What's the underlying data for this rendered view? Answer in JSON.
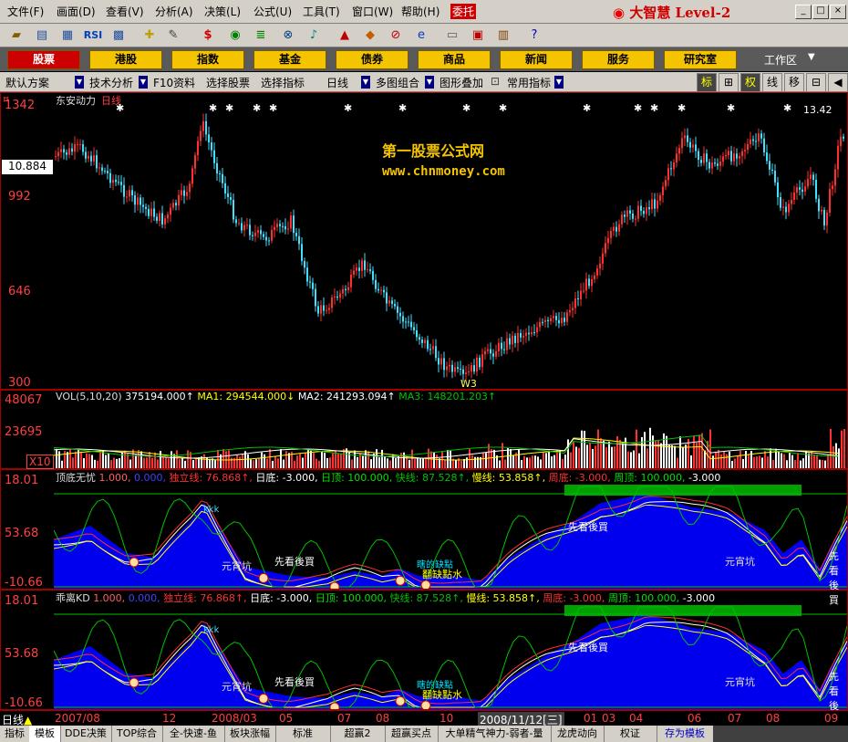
{
  "menu": [
    "文件(F)",
    "画面(D)",
    "查看(V)",
    "分析(A)",
    "决策(L)",
    "公式(U)",
    "工具(T)",
    "窗口(W)",
    "帮助(H)",
    "委托"
  ],
  "logo_text": "大智慧 Level-2",
  "markets": [
    "股票",
    "港股",
    "指数",
    "基金",
    "债券",
    "商品",
    "新闻",
    "服务",
    "研究室"
  ],
  "workspace_label": "工作区",
  "subbar": {
    "items": [
      "默认方案",
      "技术分析",
      "F10资料",
      "选择股票",
      "选择指标",
      "日线",
      "多图组合",
      "图形叠加",
      "常用指标"
    ],
    "right_buttons": [
      "标",
      "⊞",
      "权",
      "线",
      "移",
      "⊟",
      "◀"
    ]
  },
  "main_chart": {
    "stock_name": "东安动力",
    "period": "日线",
    "price_labels": [
      "1342",
      "992",
      "646",
      "300"
    ],
    "current_price": "10.884",
    "watermark_line1": "第一股票公式网",
    "watermark_line2": "www.chnmoney.com",
    "low_marker": "W3",
    "top_right_label": "13.42"
  },
  "volume": {
    "legend": [
      "VOL(5,10,20)",
      "375194.000↑",
      "MA1: 294544.000↓",
      "MA2: 241293.094↑",
      "MA3: 148201.203↑"
    ],
    "labels": [
      "48067",
      "23695"
    ],
    "multiplier": "X10"
  },
  "indicator1": {
    "name": "顶底无忧",
    "legend": [
      "1.000,",
      "0.000,",
      "独立线: 76.868↑,",
      "日底: -3.000,",
      "日顶: 100.000,",
      "快线: 87.528↑,",
      "慢线: 53.858↑,",
      "周底: -3.000,",
      "周顶: 100.000,",
      "-3.000"
    ],
    "labels": [
      "18.01",
      "53.68",
      "-10.66"
    ],
    "annotations": [
      "kkk",
      "元宵坑",
      "先看後買",
      "先看後買",
      "瞎的缺點",
      "翻缺點水",
      "元宵坑",
      "先看後買"
    ]
  },
  "indicator2": {
    "name": "乖离KD",
    "legend": [
      "1.000,",
      "0.000,",
      "独立线: 76.868↑,",
      "日底: -3.000,",
      "日顶: 100.000,",
      "快线: 87.528↑,",
      "慢线: 53.858↑,",
      "周底: -3.000,",
      "周顶: 100.000,",
      "-3.000"
    ],
    "labels": [
      "18.01",
      "53.68",
      "-10.66"
    ],
    "annotations": [
      "kkk",
      "元宵坑",
      "先看後買",
      "先看後買",
      "瞎的缺點",
      "翻缺點水",
      "元宵坑",
      "先看後買"
    ]
  },
  "date_axis": [
    "2007/08",
    "12",
    "2008/03",
    "05",
    "07",
    "08",
    "10",
    "2008/11/12[三]",
    "01",
    "03",
    "04",
    "06",
    "07",
    "08",
    "09"
  ],
  "bottom_tabs": [
    "指标",
    "模板",
    "DDE决策",
    "TOP综合",
    "全-快速-鱼",
    "板块涨幅",
    "标准",
    "超赢2",
    "超赢买点",
    "大单精气神力-弱者-量",
    "龙虎动向",
    "权证",
    "存为模板"
  ],
  "colors": {
    "up": "#ff3030",
    "down": "#40e0ff",
    "area": "#0000ee",
    "accent": "#f4c400",
    "axis": "#ff4040"
  }
}
